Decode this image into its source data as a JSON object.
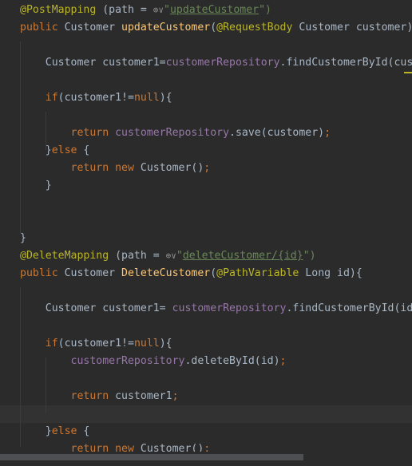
{
  "editor": {
    "theme_colors": {
      "background": "#2b2b2b",
      "keyword": "#cc7832",
      "annotation": "#bbb529",
      "method": "#ffc66d",
      "field": "#9876aa",
      "string": "#6a8759",
      "plain": "#a9b7c6"
    },
    "icons": [
      "globe-icon"
    ],
    "lines": [
      [
        {
          "t": "@PostMapping",
          "c": "ann"
        },
        {
          "t": " (path = "
        },
        {
          "t": "⊕∨",
          "c": "globe",
          "icon": "globe-icon"
        },
        {
          "t": "\"",
          "c": "str"
        },
        {
          "t": "updateCustomer",
          "c": "link"
        },
        {
          "t": "\")",
          "c": "str"
        }
      ],
      [
        {
          "t": "public ",
          "c": "kw"
        },
        {
          "t": "Customer "
        },
        {
          "t": "updateCustomer",
          "c": "fn"
        },
        {
          "t": "("
        },
        {
          "t": "@RequestBody",
          "c": "ann"
        },
        {
          "t": " Customer customer)"
        }
      ],
      [],
      [
        {
          "t": "    Customer customer1="
        },
        {
          "t": "customerRepository",
          "c": "field"
        },
        {
          "t": ".findCustomerById(cus"
        }
      ],
      [],
      [
        {
          "t": "    "
        },
        {
          "t": "if",
          "c": "kw"
        },
        {
          "t": "(customer1!="
        },
        {
          "t": "null",
          "c": "kw"
        },
        {
          "t": "){"
        }
      ],
      [],
      [
        {
          "t": "        "
        },
        {
          "t": "return ",
          "c": "kw"
        },
        {
          "t": "customerRepository",
          "c": "field"
        },
        {
          "t": ".save(customer)"
        },
        {
          "t": ";",
          "c": "kw"
        }
      ],
      [
        {
          "t": "    }"
        },
        {
          "t": "else ",
          "c": "kw"
        },
        {
          "t": "{"
        }
      ],
      [
        {
          "t": "        "
        },
        {
          "t": "return new ",
          "c": "kw"
        },
        {
          "t": "Customer()"
        },
        {
          "t": ";",
          "c": "kw"
        }
      ],
      [
        {
          "t": "    }"
        }
      ],
      [],
      [],
      [
        {
          "t": "}"
        }
      ],
      [
        {
          "t": "@DeleteMapping",
          "c": "ann"
        },
        {
          "t": " (path = "
        },
        {
          "t": "⊕∨",
          "c": "globe",
          "icon": "globe-icon"
        },
        {
          "t": "\"",
          "c": "str"
        },
        {
          "t": "deleteCustomer/{id}",
          "c": "link"
        },
        {
          "t": "\")",
          "c": "str"
        }
      ],
      [
        {
          "t": "public ",
          "c": "kw"
        },
        {
          "t": "Customer "
        },
        {
          "t": "DeleteCustomer",
          "c": "fn"
        },
        {
          "t": "("
        },
        {
          "t": "@PathVariable",
          "c": "ann"
        },
        {
          "t": " Long id){"
        }
      ],
      [],
      [
        {
          "t": "    Customer customer1= "
        },
        {
          "t": "customerRepository",
          "c": "field"
        },
        {
          "t": ".findCustomerById(id"
        }
      ],
      [],
      [
        {
          "t": "    "
        },
        {
          "t": "if",
          "c": "kw"
        },
        {
          "t": "(customer1!="
        },
        {
          "t": "null",
          "c": "kw"
        },
        {
          "t": "){"
        }
      ],
      [
        {
          "t": "        "
        },
        {
          "t": "customerRepository",
          "c": "field"
        },
        {
          "t": ".deleteById(id)"
        },
        {
          "t": ";",
          "c": "kw"
        }
      ],
      [],
      [
        {
          "t": "        "
        },
        {
          "t": "return ",
          "c": "kw"
        },
        {
          "t": "customer1"
        },
        {
          "t": ";",
          "c": "kw"
        }
      ],
      [],
      [
        {
          "t": "    }"
        },
        {
          "t": "else ",
          "c": "kw"
        },
        {
          "t": "{"
        }
      ],
      [
        {
          "t": "        "
        },
        {
          "t": "return new ",
          "c": "kw"
        },
        {
          "t": "Customer()"
        },
        {
          "t": ";",
          "c": "kw"
        }
      ]
    ],
    "current_line_index": 23
  }
}
